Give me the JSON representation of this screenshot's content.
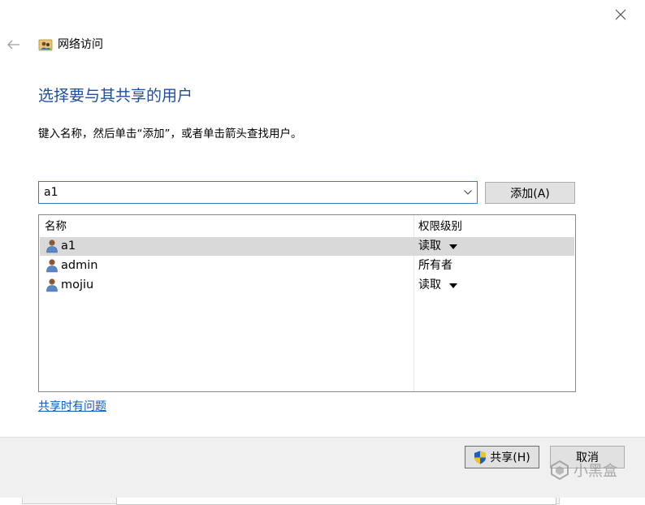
{
  "window": {
    "title": "网络访问",
    "close_icon": "close-icon",
    "back_icon": "back-arrow-icon"
  },
  "main": {
    "heading": "选择要与其共享的用户",
    "instruction": "键入名称，然后单击“添加”，或者单击箭头查找用户。",
    "name_input": {
      "value": "a1"
    },
    "add_button": "添加(A)",
    "list": {
      "columns": [
        "名称",
        "权限级别"
      ],
      "rows": [
        {
          "name": "a1",
          "permission": "读取",
          "has_dropdown": true,
          "selected": true
        },
        {
          "name": "admin",
          "permission": "所有者",
          "has_dropdown": false,
          "selected": false
        },
        {
          "name": "mojiu",
          "permission": "读取",
          "has_dropdown": true,
          "selected": false
        }
      ]
    },
    "help_link": "共享时有问题"
  },
  "footer": {
    "share_button": "共享(H)",
    "cancel_button": "取消"
  },
  "watermark": "小黑盒",
  "colors": {
    "heading": "#1f4e9c",
    "link": "#0a5bc4",
    "input_border": "#3a7ad0",
    "selected_row": "#d9d9d9",
    "footer": "#f0f0f0"
  }
}
